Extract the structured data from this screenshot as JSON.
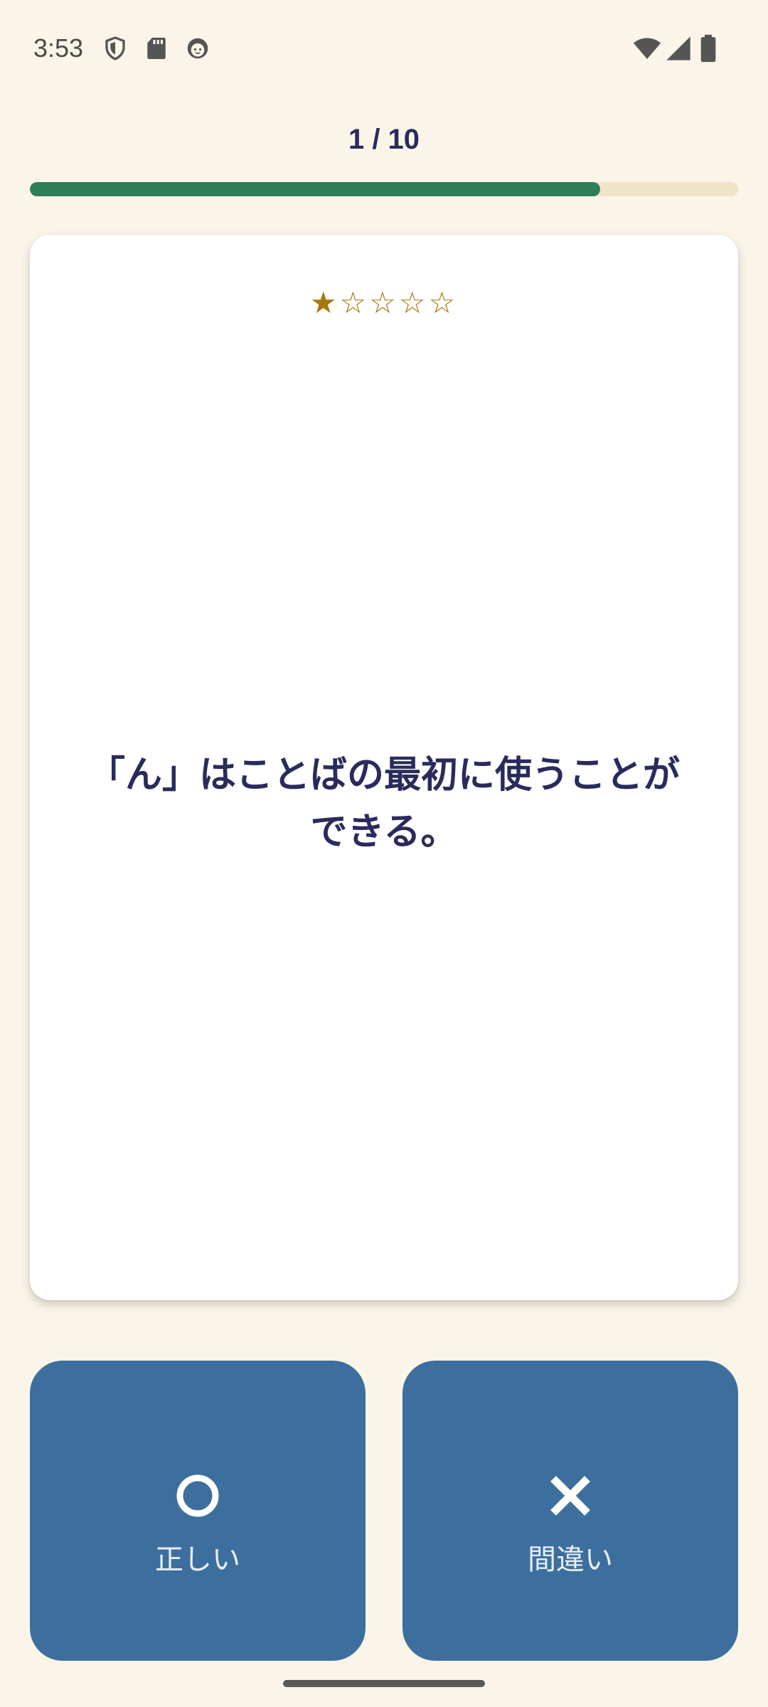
{
  "status_bar": {
    "time": "3:53",
    "left_icons": [
      "shield-icon",
      "sd-card-icon",
      "face-icon"
    ],
    "right_icons": [
      "wifi-icon",
      "cell-signal-icon",
      "battery-icon"
    ]
  },
  "progress": {
    "label": "1 / 10",
    "fill_fraction": 0.805,
    "fill_color": "#2F7E5A",
    "track_color": "#F0E4C6"
  },
  "card": {
    "stars": "★☆☆☆☆",
    "star_rating": 1,
    "star_max": 5,
    "star_color": "#A8780E",
    "question": "「ん」はことばの最初に使うことができる。"
  },
  "answers": {
    "correct": {
      "symbol": "○",
      "label": "正しい",
      "icon": "circle-icon"
    },
    "wrong": {
      "symbol": "✕",
      "label": "間違い",
      "icon": "cross-icon"
    },
    "button_color": "#3D6F9E"
  },
  "colors": {
    "background": "#FAF5E8",
    "text_primary": "#2A2B5C"
  }
}
